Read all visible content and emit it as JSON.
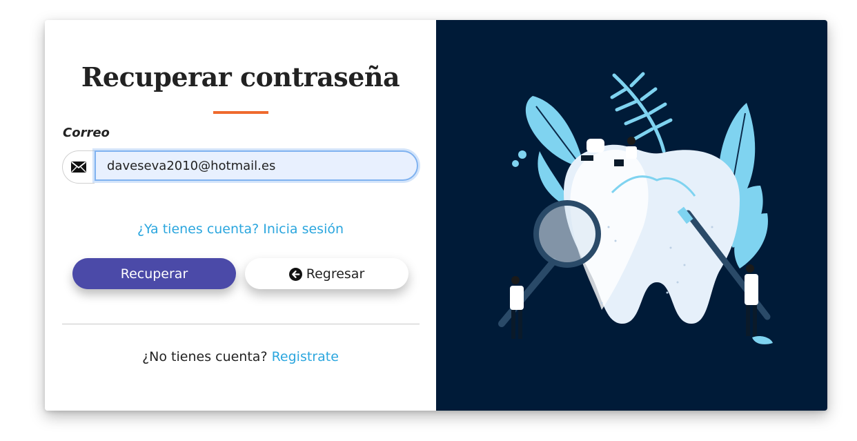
{
  "page": {
    "title": "Recuperar contraseña"
  },
  "form": {
    "email_label": "Correo",
    "email_value": "daveseva2010@hotmail.es",
    "email_icon": "envelope-icon",
    "login_prompt": "¿Ya tienes cuenta? Inicia sesión",
    "recover_button": "Recuperar",
    "back_button": "Regresar",
    "back_icon": "arrow-left-circle-icon"
  },
  "footer": {
    "register_prompt": "¿No tienes cuenta?",
    "register_link": "Registrate"
  },
  "colors": {
    "accent_underline": "#ef6a2e",
    "primary_button": "#4b4aa8",
    "link": "#2ba6de",
    "illustration_bg": "#001b38"
  }
}
